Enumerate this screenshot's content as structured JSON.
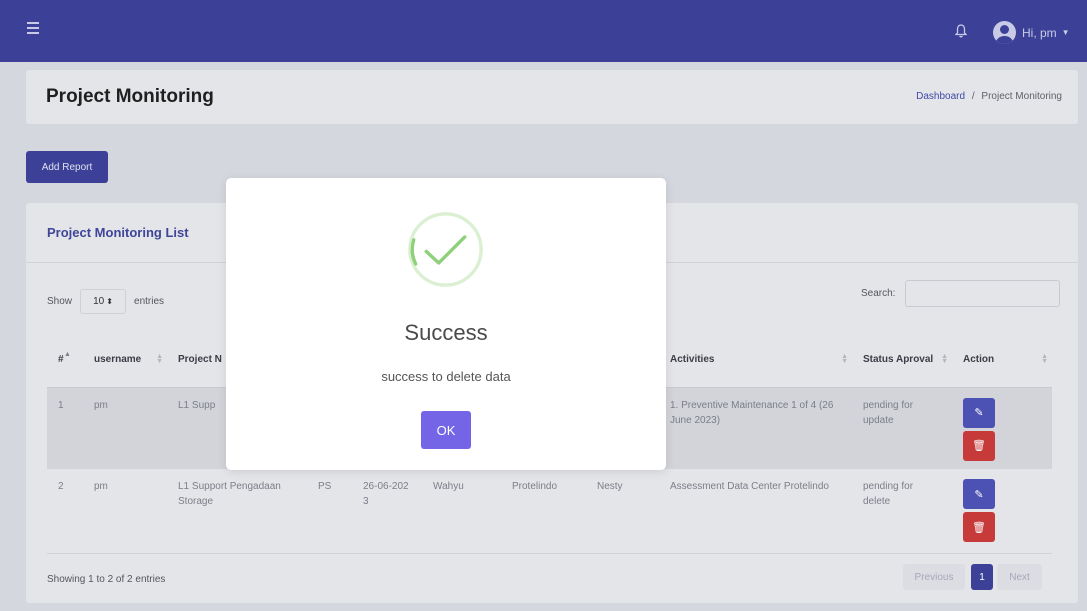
{
  "topbar": {
    "user_label": "Hi, pm"
  },
  "header": {
    "title": "Project Monitoring",
    "breadcrumb_home": "Dashboard",
    "breadcrumb_separator": "/",
    "breadcrumb_current": "Project Monitoring"
  },
  "toolbar": {
    "add_report_label": "Add Report"
  },
  "list": {
    "title": "Project Monitoring List",
    "show_label": "Show",
    "entries_label": "entries",
    "page_length": "10",
    "search_label": "Search:",
    "columns": [
      "#",
      "username",
      "Project N",
      "",
      "",
      "",
      "",
      "",
      "Activities",
      "Status Aproval",
      "Action"
    ],
    "rows": [
      {
        "num": "1",
        "username": "pm",
        "project": "L1 Supp",
        "c4": "",
        "c5": "",
        "c6": "",
        "c7": "",
        "c8": "",
        "activities": "1. Preventive Maintenance 1 of 4 (26 June 2023)",
        "status": "pending for update"
      },
      {
        "num": "2",
        "username": "pm",
        "project": "L1 Support Pengadaan Storage",
        "c4": "PS",
        "c5": "26-06-2023",
        "c6": "Wahyu",
        "c7": "Protelindo",
        "c8": "Nesty",
        "activities": "Assessment Data Center Protelindo",
        "status": "pending for delete"
      }
    ],
    "info": "Showing 1 to 2 of 2 entries",
    "pagination": {
      "previous": "Previous",
      "current_page": "1",
      "next": "Next"
    }
  },
  "modal": {
    "title": "Success",
    "message": "success to delete data",
    "ok_label": "OK"
  },
  "colors": {
    "topbar": "#3c4197",
    "accent": "#3c4197",
    "ok_button": "#7365e6",
    "success": "#8fd07a",
    "delete_button": "#c73a3a"
  }
}
